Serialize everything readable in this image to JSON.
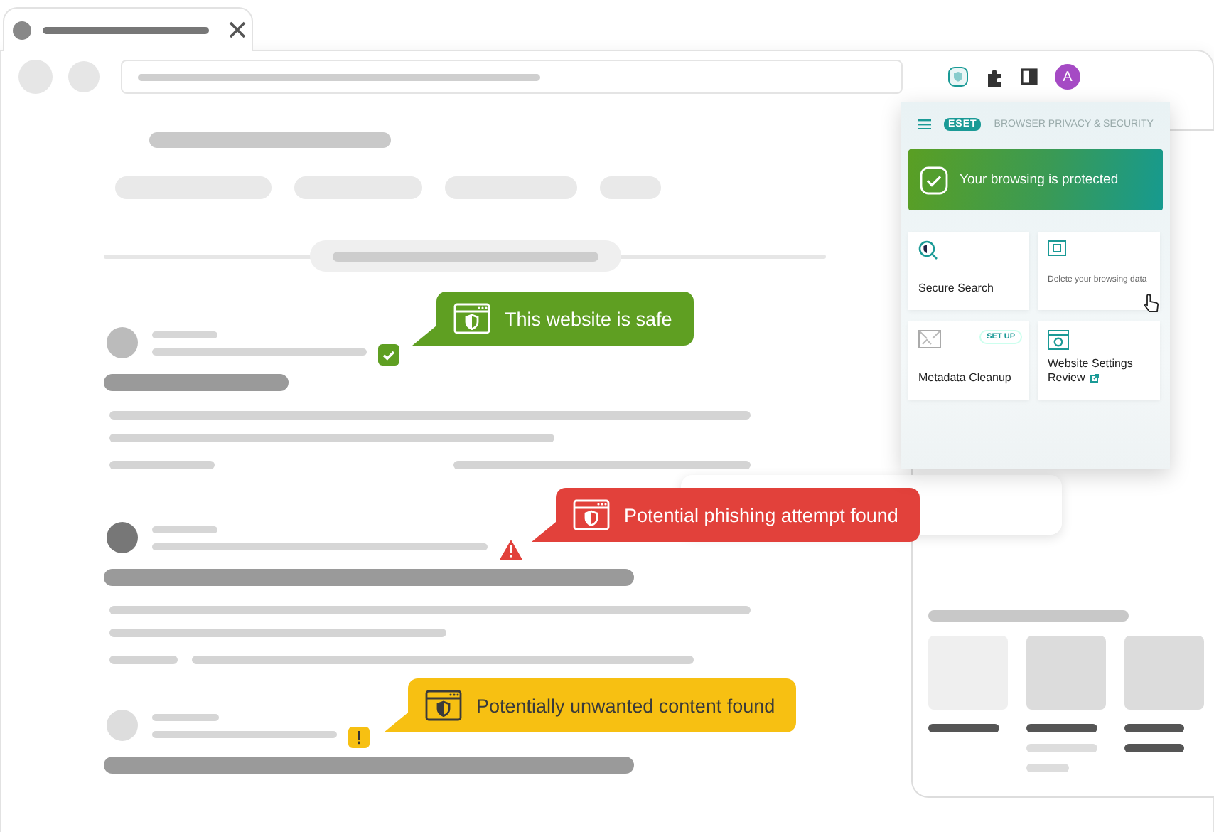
{
  "browser": {
    "avatar": "A"
  },
  "extension_popup": {
    "logo": "ESET",
    "title": "BROWSER PRIVACY & SECURITY",
    "status": "Your browsing is protected",
    "tiles": [
      {
        "kind": "search",
        "label": "Secure Search"
      },
      {
        "kind": "delete",
        "label": "Delete your browsing data"
      },
      {
        "kind": "metadata",
        "label": "Metadata Cleanup",
        "badge": "SET UP"
      },
      {
        "kind": "settings",
        "label": "Website Settings Review"
      }
    ]
  },
  "results": [
    {
      "kind": "safe",
      "message": "This website is safe"
    },
    {
      "kind": "phishing",
      "message": "Potential phishing attempt found"
    },
    {
      "kind": "unwanted",
      "message": "Potentially unwanted content found"
    }
  ]
}
